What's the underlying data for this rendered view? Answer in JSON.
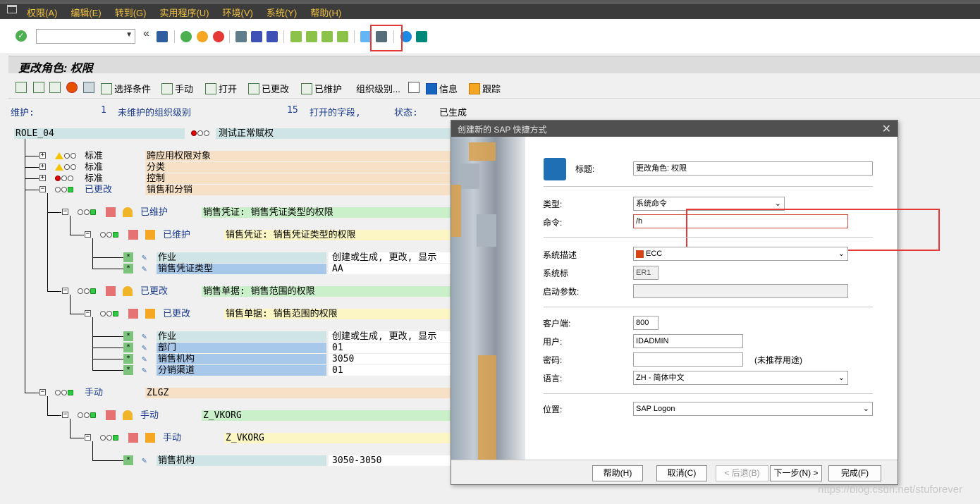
{
  "menu": [
    "权限(A)",
    "编辑(E)",
    "转到(G)",
    "实用程序(U)",
    "环境(V)",
    "系统(Y)",
    "帮助(H)"
  ],
  "title": "更改角色: 权限",
  "app_toolbar": {
    "select_criteria": "选择条件",
    "manual": "手动",
    "open": "打开",
    "changed": "已更改",
    "maintained": "已维护",
    "org_levels": "组织级别...",
    "info": "信息",
    "trace": "跟踪"
  },
  "status": {
    "maintain_label": "维护:",
    "unmaintained_count": "1",
    "unmaintained_text": "未维护的组织级别",
    "open_count": "15",
    "open_text": "打开的字段,",
    "state_label": "状态:",
    "state_value": "已生成"
  },
  "tree": {
    "role": "ROLE_04",
    "role_desc": "测试正常赋权",
    "std1": "标准",
    "std1_desc": "跨应用权限对象",
    "std2": "标准",
    "std2_desc": "分类",
    "std3": "标准",
    "std3_desc": "控制",
    "chg1": "已更改",
    "chg1_desc": "销售和分销",
    "n1_status": "已维护",
    "n1_desc": "销售凭证: 销售凭证类型的权限",
    "n1a_status": "已维护",
    "n1a_desc": "销售凭证: 销售凭证类型的权限",
    "f1_name": "作业",
    "f1_val": "创建或生成, 更改, 显示",
    "f2_name": "销售凭证类型",
    "f2_val": "AA",
    "n2_status": "已更改",
    "n2_desc": "销售单据: 销售范围的权限",
    "n2a_status": "已更改",
    "n2a_desc": "销售单据: 销售范围的权限",
    "f3_name": "作业",
    "f3_val": "创建或生成, 更改, 显示",
    "f4_name": "部门",
    "f4_val": "01",
    "f5_name": "销售机构",
    "f5_val": "3050",
    "f6_name": "分销渠道",
    "f6_val": "01",
    "man1": "手动",
    "man1_desc": "ZLGZ",
    "man2": "手动",
    "man2_desc": "Z_VKORG",
    "man3": "手动",
    "man3_desc": "Z_VKORG",
    "f7_name": "销售机构",
    "f7_val": "3050-3050",
    "star": "*"
  },
  "dialog": {
    "title": "创建新的 SAP 快捷方式",
    "close": "✕",
    "label_title": "标题:",
    "value_title": "更改角色: 权限",
    "label_type": "类型:",
    "value_type": "系统命令",
    "label_command": "命令:",
    "value_command": "/h",
    "label_sysdesc": "系统描述",
    "value_sysdesc": "ECC",
    "label_sysid": "系统标",
    "value_sysid": "ER1",
    "label_startparams": "启动参数:",
    "value_startparams": "",
    "label_client": "客户端:",
    "value_client": "800",
    "label_user": "用户:",
    "value_user": "IDADMIN",
    "label_password": "密码:",
    "value_password": "",
    "password_note": "(未推荐用途)",
    "label_lang": "语言:",
    "value_lang": "ZH - 简体中文",
    "label_location": "位置:",
    "value_location": "SAP Logon",
    "btn_help": "帮助(H)",
    "btn_cancel": "取消(C)",
    "btn_back": "< 后退(B)",
    "btn_next": "下一步(N) >",
    "btn_finish": "完成(F)"
  },
  "watermark": "https://blog.csdn.net/stuforever",
  "colors": {
    "menu_text": "#f0c040",
    "highlight": "#e53935",
    "light_green": "#2ecc40",
    "light_red": "#e00000"
  }
}
